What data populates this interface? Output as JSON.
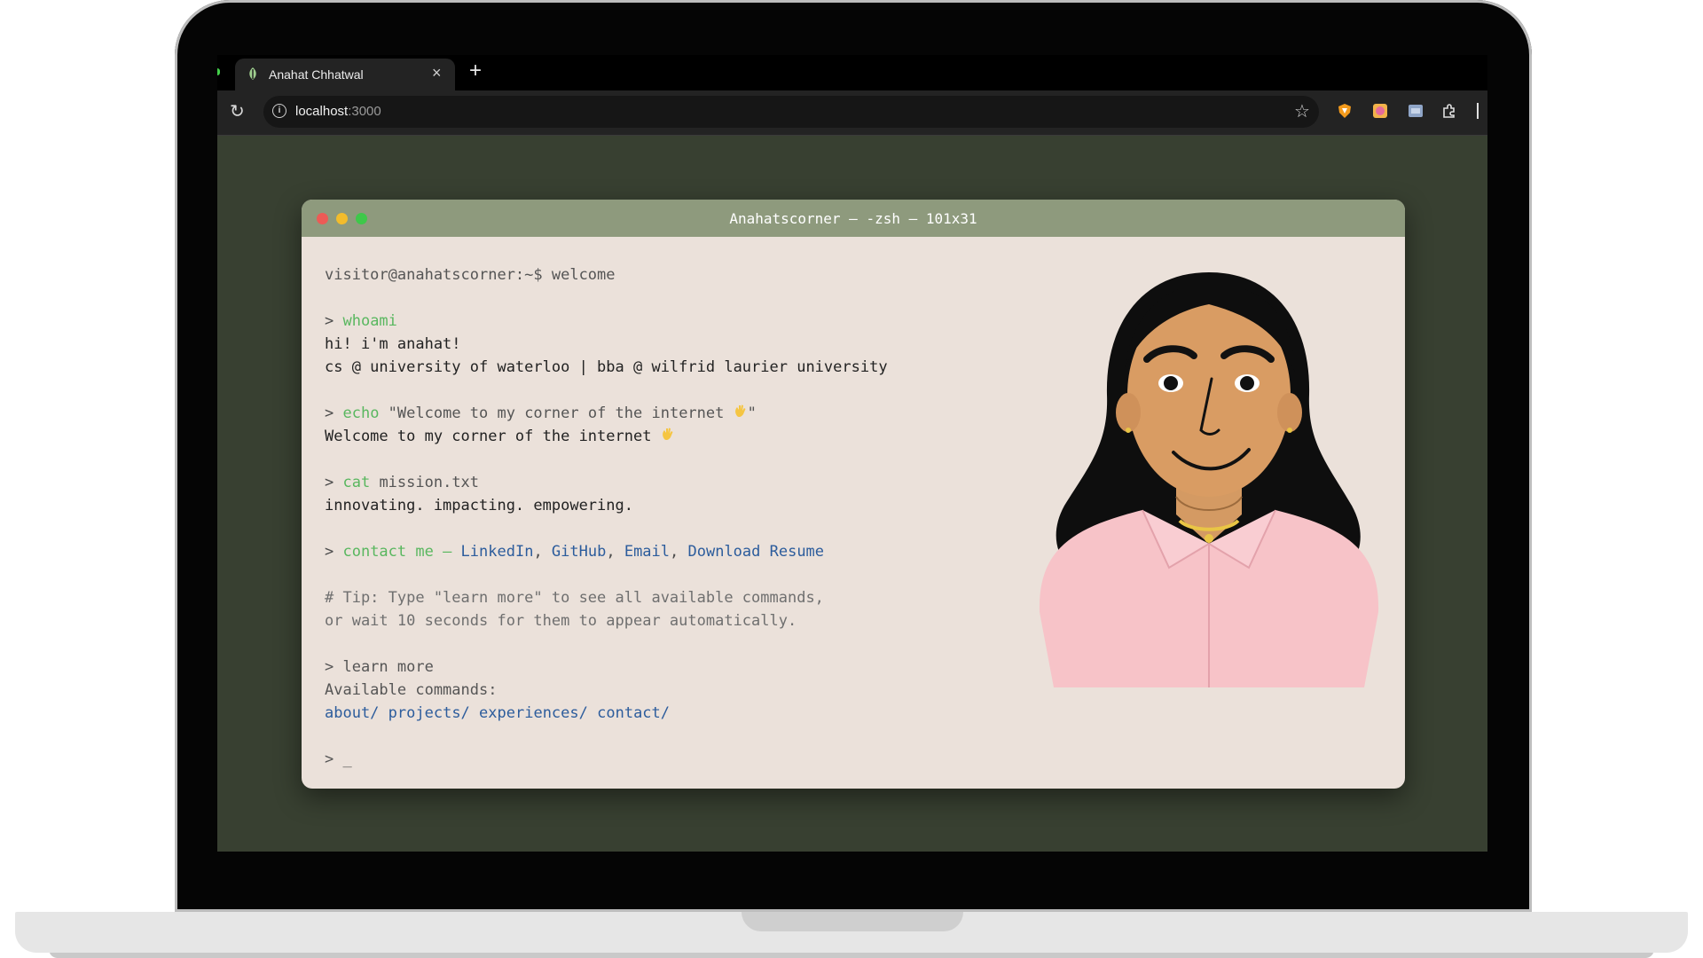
{
  "browser": {
    "tab_title": "Anahat Chhatwal",
    "tab_close": "×",
    "new_tab": "+",
    "reload": "↻",
    "info": "i",
    "url_host": "localhost",
    "url_port": ":3000",
    "star": "☆"
  },
  "terminal": {
    "title": "Anahatscorner — -zsh — 101x31",
    "prompt_line": "visitor@anahatscorner:~$ welcome",
    "whoami": {
      "prompt": "> ",
      "cmd": "whoami"
    },
    "intro_1": "hi! i'm anahat!",
    "intro_2": "cs @ university of waterloo | bba @ wilfrid laurier university",
    "echo": {
      "prompt": "> ",
      "cmd": "echo",
      "arg": " \"Welcome to my corner of the internet ",
      "end": "\""
    },
    "welcome": "Welcome to my corner of the internet ",
    "cat": {
      "prompt": "> ",
      "cmd": "cat",
      "arg": " mission.txt"
    },
    "mission": "innovating. impacting. empowering.",
    "contact": {
      "prompt": "> ",
      "label": "contact me — ",
      "links": [
        "LinkedIn",
        "GitHub",
        "Email",
        "Download Resume"
      ],
      "sep": ", "
    },
    "tip_1": "# Tip: Type \"learn more\" to see all available commands,",
    "tip_2": "or wait 10 seconds for them to appear automatically.",
    "learn": "> learn more",
    "available": "Available commands:",
    "commands": [
      "about/",
      "projects/",
      "experiences/",
      "contact/"
    ],
    "cursor_line": "> _"
  },
  "colors": {
    "page_bg": "#384031",
    "titlebar": "#8e9a7d",
    "terminal_bg": "#ebe1da",
    "command": "#59b75f",
    "link": "#2c5c9c"
  }
}
